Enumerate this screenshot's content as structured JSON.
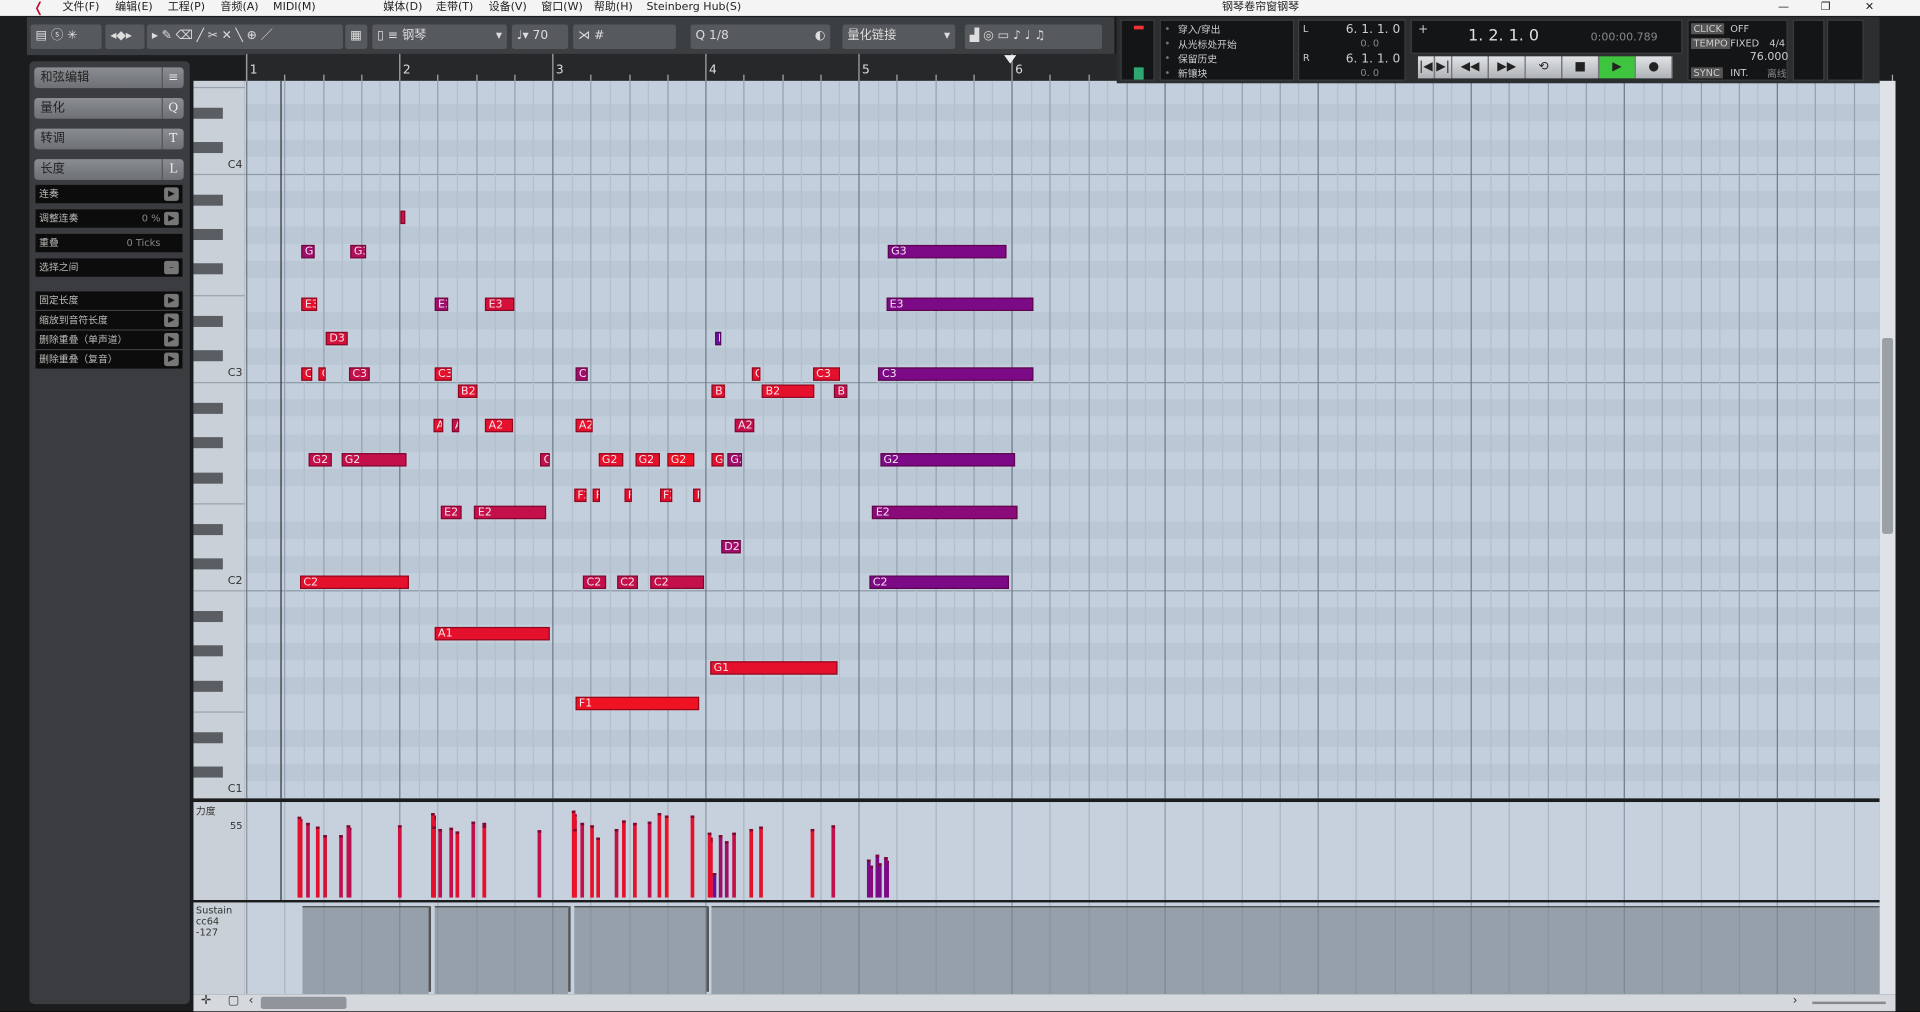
{
  "window": {
    "title": "钢琴卷帘窗钢琴",
    "minimize": "—",
    "restore": "❐",
    "close": "✕"
  },
  "menu": [
    "文件(F)",
    "编辑(E)",
    "工程(P)",
    "音频(A)",
    "MIDI(M)",
    "媒体(D)",
    "走带(T)",
    "设备(V)",
    "窗口(W)",
    "帮助(H)",
    "Steinberg Hub(S)"
  ],
  "toolbar": {
    "instrument": "钢琴",
    "velocity": "70",
    "quantize_label": "Q",
    "quantize": "1/8",
    "quantize_link": "量化链接",
    "tool_icons": [
      "▸",
      "✎",
      "⌫",
      "╱",
      "✂",
      "✕",
      "╲",
      "⊕",
      "／"
    ]
  },
  "ruler": {
    "bars": [
      "1",
      "2",
      "3",
      "4",
      "5",
      "6"
    ]
  },
  "left_panel": {
    "sections": [
      {
        "label": "和弦编辑",
        "key": "≡"
      },
      {
        "label": "量化",
        "key": "Q"
      },
      {
        "label": "转调",
        "key": "T"
      },
      {
        "label": "长度",
        "key": "L"
      }
    ],
    "length_rows": [
      {
        "label": "连奏"
      },
      {
        "label": "调整连奏",
        "value": "0 %"
      },
      {
        "label": "重叠",
        "value": "0 Ticks"
      },
      {
        "label": "选择之间"
      }
    ],
    "fixed_rows": [
      {
        "label": "固定长度"
      },
      {
        "label": "缩放到音符长度"
      },
      {
        "label": "删除重叠（单声道）"
      },
      {
        "label": "删除重叠（复音）"
      }
    ]
  },
  "keyboard": {
    "labels": [
      "C4",
      "C3",
      "C2",
      "C1"
    ]
  },
  "lanes": {
    "velocity_label": "力度",
    "velocity_value": "55",
    "sustain_label": "Sustain",
    "sustain_value": "cc64 -127"
  },
  "transport": {
    "options": [
      "穿入/穿出",
      "从光标处开始",
      "保留历史",
      "新镶块"
    ],
    "left_locator": "6. 1. 1. 0",
    "left_offset": "0. 0",
    "right_locator": "6. 1. 1. 0",
    "right_offset": "0. 0",
    "position": "1. 2. 1. 0",
    "time": "0:00:00.789",
    "click": "CLICK",
    "click_state": "OFF",
    "tempo": "TEMPO",
    "tempo_mode": "FIXED",
    "signature": "4/4",
    "bpm": "76.000",
    "sync": "SYNC",
    "sync_mode": "INT.",
    "offline": "离线",
    "buttons": [
      "|◀",
      "▶|",
      "◀◀",
      "▶▶",
      "⟲",
      "■",
      "▶",
      "●"
    ],
    "play_color": "#3fc43f"
  },
  "colors": {
    "red": "#e5102c",
    "crimson": "#c4104a",
    "magenta": "#a00e6c",
    "purple": "#7c0a86"
  },
  "notes": [
    {
      "name": "A3",
      "start": 2.01,
      "len": 0.03,
      "color": "#d01040",
      "vel": 58
    },
    {
      "name": "G3",
      "start": 1.36,
      "len": 0.09,
      "color": "#a00e6c",
      "vel": 62
    },
    {
      "name": "G3",
      "start": 1.68,
      "len": 0.1,
      "color": "#b0105a",
      "vel": 56
    },
    {
      "name": "G3",
      "start": 5.19,
      "len": 0.78,
      "color": "#7c0a86",
      "vel": 30
    },
    {
      "name": "E3",
      "start": 1.36,
      "len": 0.1,
      "color": "#e5102c",
      "vel": 60
    },
    {
      "name": "E3",
      "start": 2.23,
      "len": 0.09,
      "color": "#a00e6c",
      "vel": 66
    },
    {
      "name": "E3",
      "start": 2.56,
      "len": 0.19,
      "color": "#d41038",
      "vel": 60
    },
    {
      "name": "E3",
      "start": 5.18,
      "len": 0.96,
      "color": "#7c0a86",
      "vel": 33
    },
    {
      "name": "D3",
      "start": 1.52,
      "len": 0.14,
      "color": "#d41038",
      "vel": 50
    },
    {
      "name": "D3",
      "start": 4.06,
      "len": 0.04,
      "color": "#6a10a0",
      "vel": 20
    },
    {
      "name": "C3",
      "start": 1.36,
      "len": 0.07,
      "color": "#e5102c",
      "vel": 63
    },
    {
      "name": "C3",
      "start": 1.47,
      "len": 0.05,
      "color": "#e5102c",
      "vel": 57
    },
    {
      "name": "C3",
      "start": 1.67,
      "len": 0.14,
      "color": "#c4104a",
      "vel": 58
    },
    {
      "name": "C3",
      "start": 2.23,
      "len": 0.11,
      "color": "#e5102c",
      "vel": 64
    },
    {
      "name": "C3",
      "start": 3.15,
      "len": 0.08,
      "color": "#a00e6c",
      "vel": 62
    },
    {
      "name": "C3",
      "start": 4.3,
      "len": 0.06,
      "color": "#e5102c",
      "vel": 55
    },
    {
      "name": "C3",
      "start": 4.7,
      "len": 0.18,
      "color": "#e5102c",
      "vel": 55
    },
    {
      "name": "C3",
      "start": 5.13,
      "len": 1.01,
      "color": "#7c0a86",
      "vel": 35
    },
    {
      "name": "B2",
      "start": 2.38,
      "len": 0.13,
      "color": "#e01030",
      "vel": 53
    },
    {
      "name": "B2",
      "start": 4.04,
      "len": 0.09,
      "color": "#e5102c",
      "vel": 48
    },
    {
      "name": "B2",
      "start": 4.37,
      "len": 0.34,
      "color": "#e5102c",
      "vel": 57
    },
    {
      "name": "B2",
      "start": 4.84,
      "len": 0.09,
      "color": "#c4104a",
      "vel": 58
    },
    {
      "name": "A2",
      "start": 2.22,
      "len": 0.07,
      "color": "#e5102c",
      "vel": 68
    },
    {
      "name": "A2",
      "start": 2.34,
      "len": 0.05,
      "color": "#c4104a",
      "vel": 56
    },
    {
      "name": "A2",
      "start": 2.56,
      "len": 0.18,
      "color": "#e5102c",
      "vel": 58
    },
    {
      "name": "A2",
      "start": 3.15,
      "len": 0.11,
      "color": "#e5102c",
      "vel": 67
    },
    {
      "name": "A2",
      "start": 4.19,
      "len": 0.13,
      "color": "#c4104a",
      "vel": 52
    },
    {
      "name": "G2",
      "start": 1.41,
      "len": 0.15,
      "color": "#c4104a",
      "vel": 60
    },
    {
      "name": "G2",
      "start": 1.62,
      "len": 0.43,
      "color": "#c4104a",
      "vel": 50
    },
    {
      "name": "G2",
      "start": 2.92,
      "len": 0.06,
      "color": "#c4104a",
      "vel": 54
    },
    {
      "name": "G2",
      "start": 3.3,
      "len": 0.16,
      "color": "#e5102c",
      "vel": 48
    },
    {
      "name": "G2",
      "start": 3.54,
      "len": 0.16,
      "color": "#e5102c",
      "vel": 60
    },
    {
      "name": "G2",
      "start": 3.75,
      "len": 0.18,
      "color": "#ee1222",
      "vel": 66
    },
    {
      "name": "G2",
      "start": 4.04,
      "len": 0.08,
      "color": "#e5102c",
      "vel": 46
    },
    {
      "name": "G2",
      "start": 4.14,
      "len": 0.1,
      "color": "#a00e6c",
      "vel": 45
    },
    {
      "name": "G2",
      "start": 5.14,
      "len": 0.88,
      "color": "#7c0a86",
      "vel": 28
    },
    {
      "name": "F2",
      "start": 3.14,
      "len": 0.08,
      "color": "#e5102c",
      "vel": 70
    },
    {
      "name": "F2",
      "start": 3.26,
      "len": 0.05,
      "color": "#e5102c",
      "vel": 58
    },
    {
      "name": "F2",
      "start": 3.47,
      "len": 0.05,
      "color": "#e5102c",
      "vel": 62
    },
    {
      "name": "F2",
      "start": 3.7,
      "len": 0.08,
      "color": "#e5102c",
      "vel": 68
    },
    {
      "name": "F2",
      "start": 3.92,
      "len": 0.05,
      "color": "#e5102c",
      "vel": 66
    },
    {
      "name": "E2",
      "start": 2.27,
      "len": 0.14,
      "color": "#c4104a",
      "vel": 55
    },
    {
      "name": "E2",
      "start": 2.49,
      "len": 0.47,
      "color": "#c4104a",
      "vel": 61
    },
    {
      "name": "E2",
      "start": 5.09,
      "len": 0.95,
      "color": "#8a0a7a",
      "vel": 26
    },
    {
      "name": "D2",
      "start": 4.1,
      "len": 0.13,
      "color": "#a00e6c",
      "vel": 50
    },
    {
      "name": "C2",
      "start": 1.35,
      "len": 0.71,
      "color": "#e5102c",
      "vel": 65
    },
    {
      "name": "C2",
      "start": 3.2,
      "len": 0.15,
      "color": "#c4104a",
      "vel": 60
    },
    {
      "name": "C2",
      "start": 3.42,
      "len": 0.14,
      "color": "#c4104a",
      "vel": 55
    },
    {
      "name": "C2",
      "start": 3.64,
      "len": 0.35,
      "color": "#c4104a",
      "vel": 61
    },
    {
      "name": "C2",
      "start": 5.07,
      "len": 0.91,
      "color": "#7c0a86",
      "vel": 31
    },
    {
      "name": "A1",
      "start": 2.23,
      "len": 0.75,
      "color": "#e5102c",
      "vel": 57
    },
    {
      "name": "G1",
      "start": 4.03,
      "len": 0.83,
      "color": "#e5102c",
      "vel": 52
    },
    {
      "name": "F1",
      "start": 3.15,
      "len": 0.81,
      "color": "#ee1222",
      "vel": 55
    }
  ],
  "sustain": {
    "on_starts": [
      1.37,
      2.23,
      3.14,
      4.04
    ],
    "off_points": [
      2.19,
      3.1,
      4.01
    ]
  }
}
